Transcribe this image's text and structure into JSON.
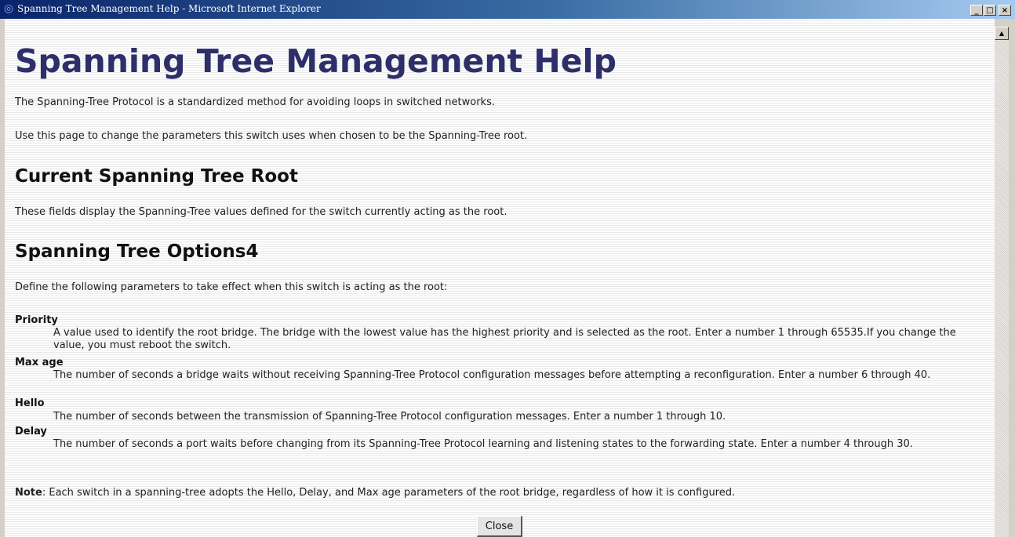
{
  "window": {
    "title": "Spanning Tree Management Help - Microsoft Internet Explorer",
    "controls": {
      "minimize": "_",
      "maximize": "□",
      "close": "×"
    }
  },
  "page": {
    "heading": "Spanning Tree Management Help",
    "intro1": "The Spanning-Tree Protocol is a standardized method for avoiding loops in switched networks.",
    "intro2": "Use this page to change the parameters this switch uses when chosen to be the Spanning-Tree root.",
    "section_root": {
      "title": "Current Spanning Tree Root",
      "text": "These fields display the Spanning-Tree values defined for the switch currently acting as the root."
    },
    "section_options": {
      "title": "Spanning Tree Options4",
      "text": "Define the following parameters to take effect when this switch is acting as the root:",
      "params": [
        {
          "term": "Priority",
          "desc": "A value used to identify the root bridge. The bridge with the lowest value has the highest priority and is selected as the root. Enter a number 1 through 65535.If you change the value, you must reboot the switch."
        },
        {
          "term": "Max age",
          "desc": "The number of seconds a bridge waits without receiving Spanning-Tree Protocol configuration messages before attempting a reconfiguration. Enter a number 6 through 40."
        },
        {
          "term": "Hello",
          "desc": "The number of seconds between the transmission of Spanning-Tree Protocol configuration messages. Enter a number 1 through 10."
        },
        {
          "term": "Delay",
          "desc": "The number of seconds a port waits before changing from its Spanning-Tree Protocol learning and listening states to the forwarding state. Enter a number 4 through 30."
        }
      ]
    },
    "note": {
      "label": "Note",
      "text": ": Each switch in a spanning-tree adopts the Hello, Delay, and Max age parameters of the root bridge, regardless of how it is configured."
    },
    "close_label": "Close"
  },
  "icons": {
    "browser": "ie-logo-icon",
    "scroll_up": "scroll-up-arrow-icon"
  }
}
